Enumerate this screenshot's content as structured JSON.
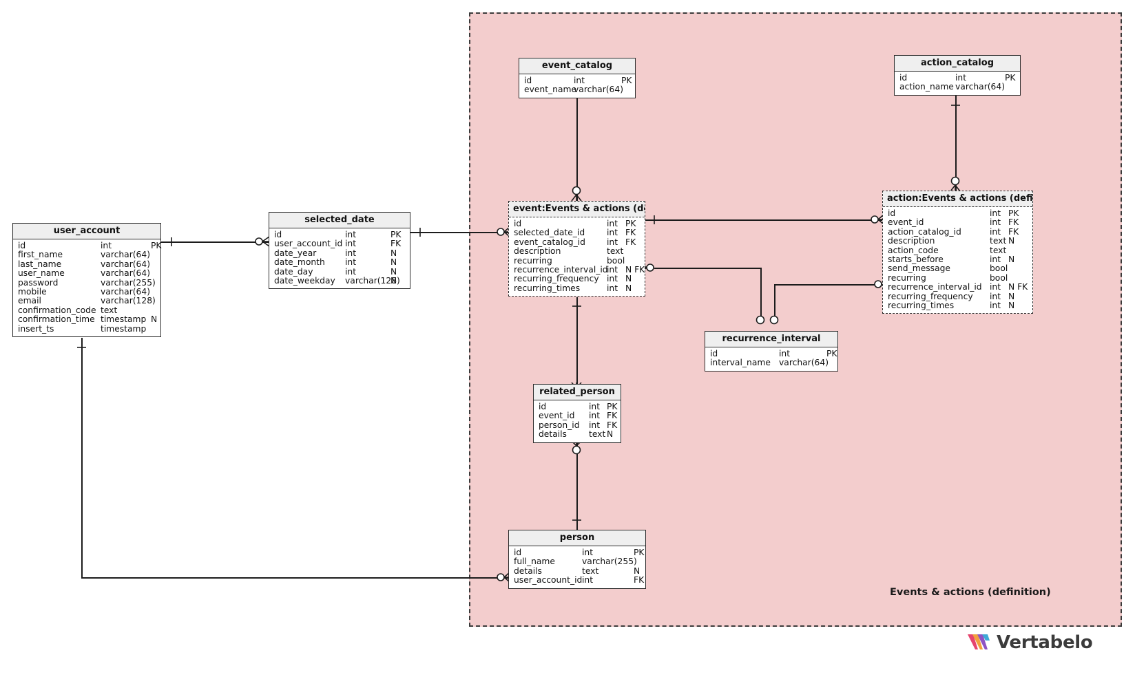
{
  "diagram": {
    "subject_area_label": "Events & actions (definition)",
    "subject_area_color": "#f3cdcd",
    "background_color": "#ffffff",
    "border_color": "#2b2b2b",
    "header_fill": "#efefef"
  },
  "branding": {
    "name": "Vertabelo",
    "logo_colors": [
      "#e6446e",
      "#f2a03d",
      "#8e54c4",
      "#3fa9d6"
    ]
  },
  "tables": {
    "user_account": {
      "name": "user_account",
      "columns": [
        {
          "name": "id",
          "type": "int",
          "key": "PK"
        },
        {
          "name": "first_name",
          "type": "varchar(64)",
          "key": ""
        },
        {
          "name": "last_name",
          "type": "varchar(64)",
          "key": ""
        },
        {
          "name": "user_name",
          "type": "varchar(64)",
          "key": ""
        },
        {
          "name": "password",
          "type": "varchar(255)",
          "key": ""
        },
        {
          "name": "mobile",
          "type": "varchar(64)",
          "key": ""
        },
        {
          "name": "email",
          "type": "varchar(128)",
          "key": ""
        },
        {
          "name": "confirmation_code",
          "type": "text",
          "key": ""
        },
        {
          "name": "confirmation_time",
          "type": "timestamp",
          "key": "N"
        },
        {
          "name": "insert_ts",
          "type": "timestamp",
          "key": ""
        }
      ]
    },
    "selected_date": {
      "name": "selected_date",
      "columns": [
        {
          "name": "id",
          "type": "int",
          "key": "PK"
        },
        {
          "name": "user_account_id",
          "type": "int",
          "key": "FK"
        },
        {
          "name": "date_year",
          "type": "int",
          "key": "N"
        },
        {
          "name": "date_month",
          "type": "int",
          "key": "N"
        },
        {
          "name": "date_day",
          "type": "int",
          "key": "N"
        },
        {
          "name": "date_weekday",
          "type": "varchar(128)",
          "key": "N"
        }
      ]
    },
    "event_catalog": {
      "name": "event_catalog",
      "columns": [
        {
          "name": "id",
          "type": "int",
          "key": "PK"
        },
        {
          "name": "event_name",
          "type": "varchar(64)",
          "key": ""
        }
      ]
    },
    "action_catalog": {
      "name": "action_catalog",
      "columns": [
        {
          "name": "id",
          "type": "int",
          "key": "PK"
        },
        {
          "name": "action_name",
          "type": "varchar(64)",
          "key": ""
        }
      ]
    },
    "event": {
      "name": "event:Events & actions (defini",
      "columns": [
        {
          "name": "id",
          "type": "int",
          "key": "PK"
        },
        {
          "name": "selected_date_id",
          "type": "int",
          "key": "FK"
        },
        {
          "name": "event_catalog_id",
          "type": "int",
          "key": "FK"
        },
        {
          "name": "description",
          "type": "text",
          "key": ""
        },
        {
          "name": "recurring",
          "type": "bool",
          "key": ""
        },
        {
          "name": "recurrence_interval_id",
          "type": "int",
          "key": "N FK"
        },
        {
          "name": "recurring_frequency",
          "type": "int",
          "key": "N"
        },
        {
          "name": "recurring_times",
          "type": "int",
          "key": "N"
        }
      ]
    },
    "action": {
      "name": "action:Events & actions (definitio",
      "columns": [
        {
          "name": "id",
          "type": "int",
          "key": "PK"
        },
        {
          "name": "event_id",
          "type": "int",
          "key": "FK"
        },
        {
          "name": "action_catalog_id",
          "type": "int",
          "key": "FK"
        },
        {
          "name": "description",
          "type": "text",
          "key": "N"
        },
        {
          "name": "action_code",
          "type": "text",
          "key": ""
        },
        {
          "name": "starts_before",
          "type": "int",
          "key": "N"
        },
        {
          "name": "send_message",
          "type": "bool",
          "key": ""
        },
        {
          "name": "recurring",
          "type": "bool",
          "key": ""
        },
        {
          "name": "recurrence_interval_id",
          "type": "int",
          "key": "N FK"
        },
        {
          "name": "recurring_frequency",
          "type": "int",
          "key": "N"
        },
        {
          "name": "recurring_times",
          "type": "int",
          "key": "N"
        }
      ]
    },
    "recurrence_interval": {
      "name": "recurrence_interval",
      "columns": [
        {
          "name": "id",
          "type": "int",
          "key": "PK"
        },
        {
          "name": "interval_name",
          "type": "varchar(64)",
          "key": ""
        }
      ]
    },
    "related_person": {
      "name": "related_person",
      "columns": [
        {
          "name": "id",
          "type": "int",
          "key": "PK"
        },
        {
          "name": "event_id",
          "type": "int",
          "key": "FK"
        },
        {
          "name": "person_id",
          "type": "int",
          "key": "FK"
        },
        {
          "name": "details",
          "type": "text",
          "key": "N"
        }
      ]
    },
    "person": {
      "name": "person",
      "columns": [
        {
          "name": "id",
          "type": "int",
          "key": "PK"
        },
        {
          "name": "full_name",
          "type": "varchar(255)",
          "key": ""
        },
        {
          "name": "details",
          "type": "text",
          "key": "N"
        },
        {
          "name": "user_account_id",
          "type": "int",
          "key": "FK"
        }
      ]
    }
  }
}
